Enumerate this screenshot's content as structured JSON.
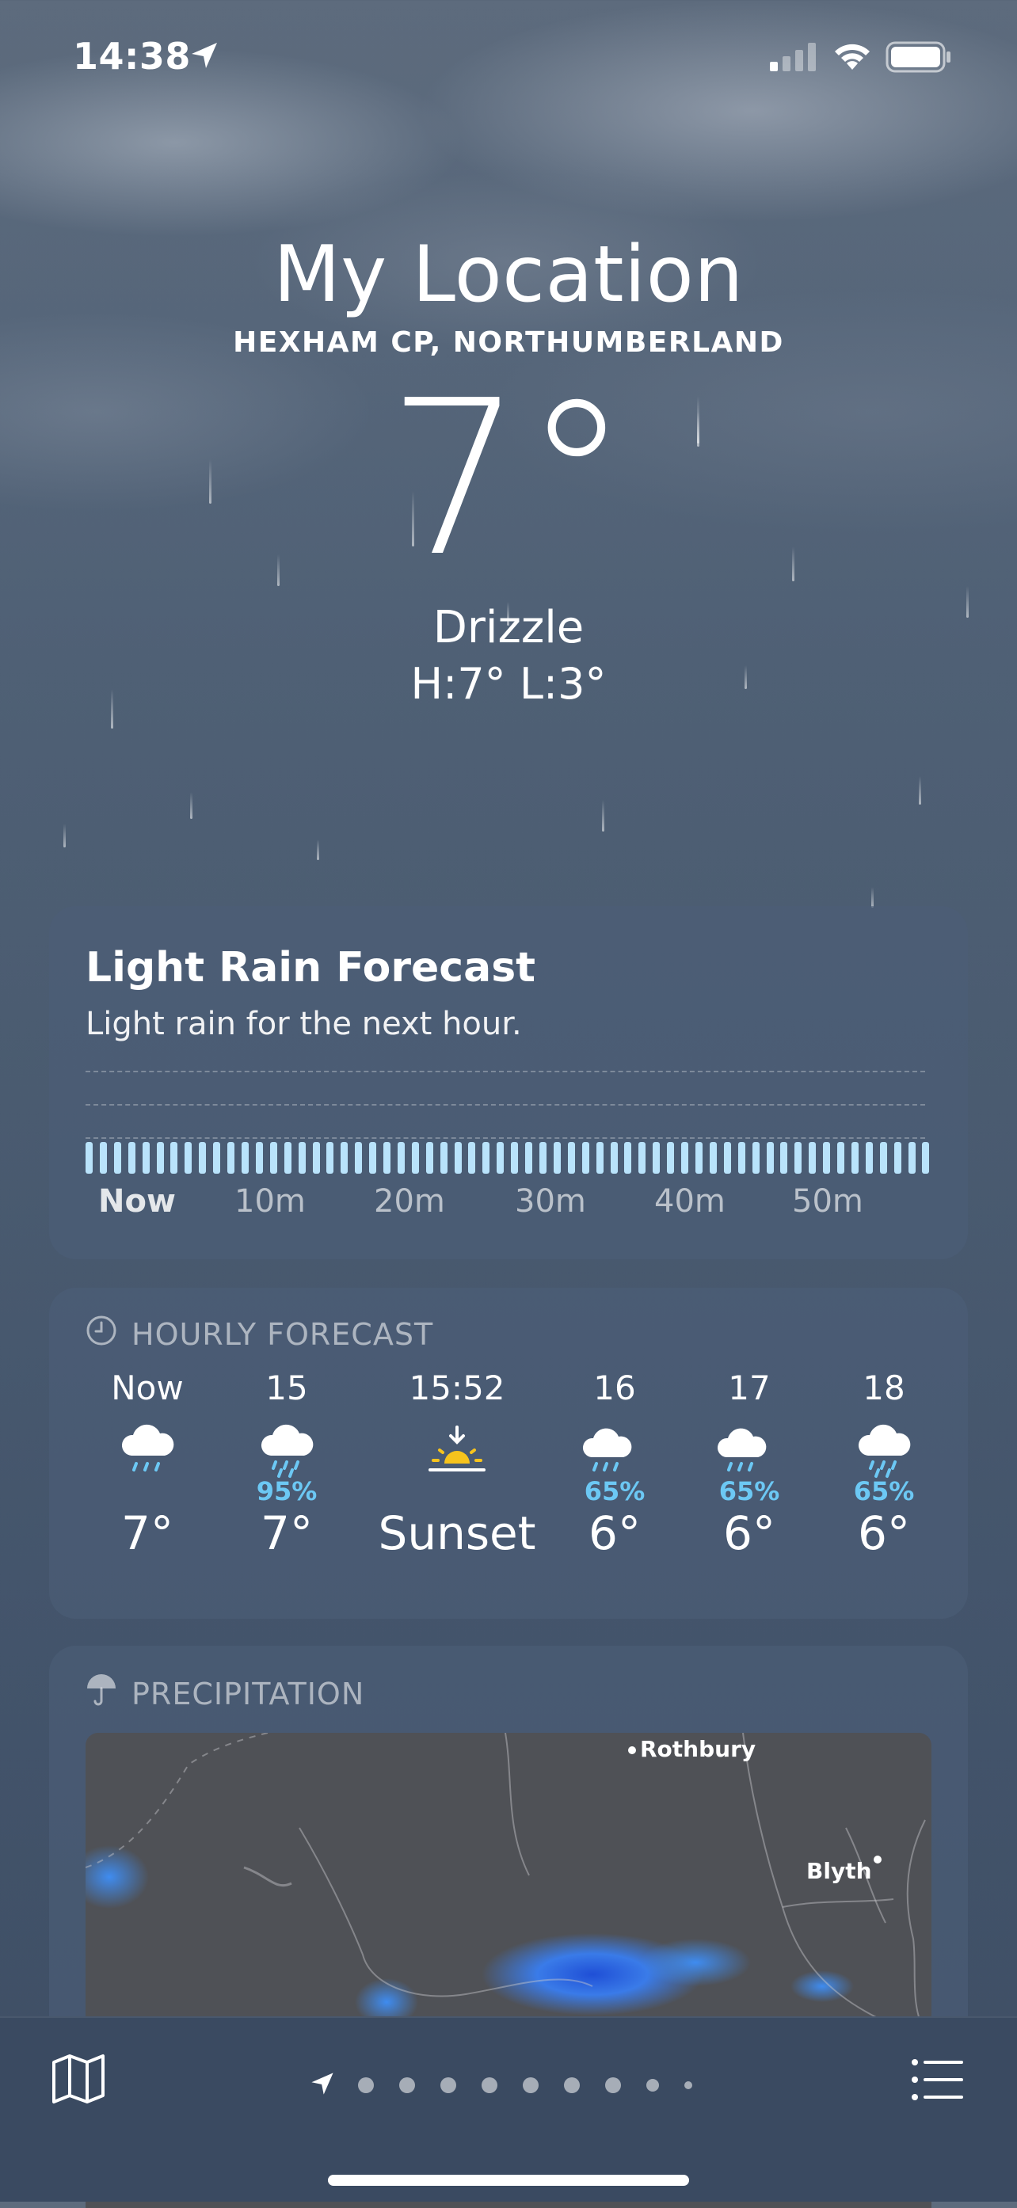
{
  "status_bar": {
    "time": "14:38"
  },
  "location": {
    "title": "My Location",
    "subtitle": "HEXHAM CP, NORTHUMBERLAND"
  },
  "current": {
    "temperature": "7°",
    "condition": "Drizzle",
    "high_low": "H:7°  L:3°"
  },
  "rain_card": {
    "title": "Light Rain Forecast",
    "subtitle": "Light rain for the next hour.",
    "ticks": [
      "Now",
      "10m",
      "20m",
      "30m",
      "40m",
      "50m"
    ],
    "intensity_level": 0.2
  },
  "hourly": {
    "header": "HOURLY FORECAST",
    "items": [
      {
        "label": "Now",
        "icon": "cloud-rain-icon",
        "pct": "",
        "temp": "7°"
      },
      {
        "label": "15",
        "icon": "cloud-rain-icon",
        "pct": "95%",
        "temp": "7°"
      },
      {
        "label": "15:52",
        "icon": "sunset-icon",
        "pct": "",
        "temp": "Sunset"
      },
      {
        "label": "16",
        "icon": "cloud-moon-rain-icon",
        "pct": "65%",
        "temp": "6°"
      },
      {
        "label": "17",
        "icon": "cloud-moon-rain-icon",
        "pct": "65%",
        "temp": "6°"
      },
      {
        "label": "18",
        "icon": "cloud-rain-icon",
        "pct": "65%",
        "temp": "6°"
      }
    ]
  },
  "precipitation": {
    "header": "PRECIPITATION",
    "map_labels": [
      "Rothbury",
      "Blyth"
    ]
  },
  "colors": {
    "accent_rain": "#6cc8f4",
    "rain_bar": "#b9e3fb",
    "sun": "#f7c31d"
  }
}
